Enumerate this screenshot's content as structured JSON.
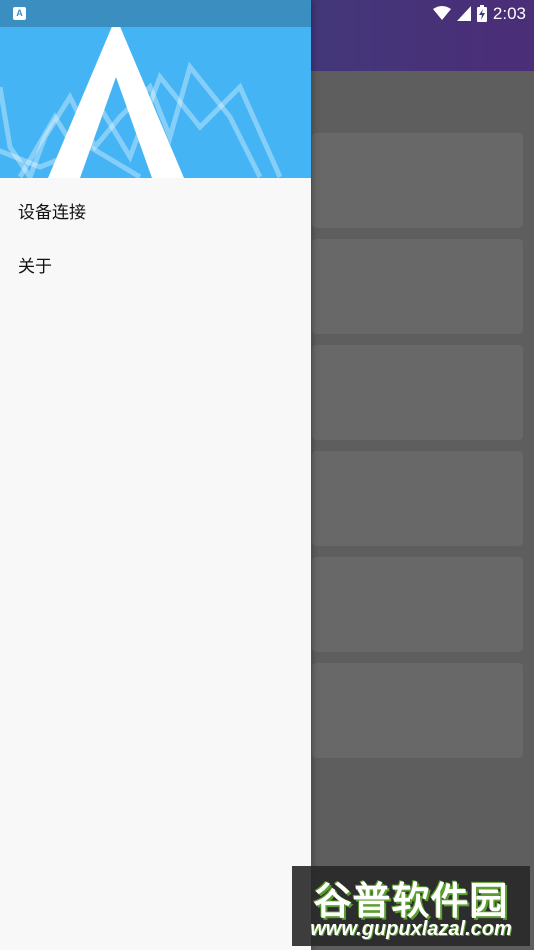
{
  "status_bar": {
    "notification_icon": "A",
    "time": "2:03",
    "icons": [
      "wifi-icon",
      "cell-signal-icon",
      "battery-charging-icon"
    ]
  },
  "drawer": {
    "menu": [
      {
        "label": "设备连接"
      },
      {
        "label": "关于"
      }
    ]
  },
  "watermark": {
    "title": "谷普软件园",
    "url": "www.gupuxlazal.com"
  },
  "colors": {
    "header": "#44b4f5",
    "status_bar_left": "#3a8fc0",
    "app_bar": "#433779",
    "drawer_bg": "#f8f8f8",
    "scrim": "#5e5e5e"
  }
}
